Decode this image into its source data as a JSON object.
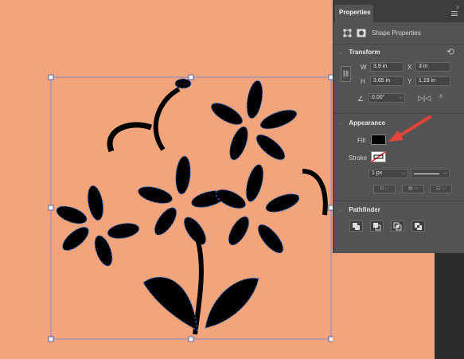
{
  "canvas": {
    "background_color": "#f3a47a"
  },
  "panel": {
    "tab_label": "Properties",
    "shape_properties_label": "Shape Properties",
    "transform": {
      "title": "Transform",
      "w_label": "W",
      "w_value": "3.9 in",
      "x_label": "X",
      "x_value": "3 in",
      "h_label": "H",
      "h_value": "3.65 in",
      "y_label": "Y",
      "y_value": "1.19 in",
      "angle_value": "0.00°"
    },
    "appearance": {
      "title": "Appearance",
      "fill_label": "Fill",
      "fill_color": "#000000",
      "stroke_label": "Stroke",
      "stroke_width_value": "1 px"
    },
    "pathfinder": {
      "title": "Pathfinder"
    }
  },
  "colors": {
    "panel_bg": "#535353",
    "accent_arrow": "#e6433a",
    "selection": "#3b82f6"
  }
}
